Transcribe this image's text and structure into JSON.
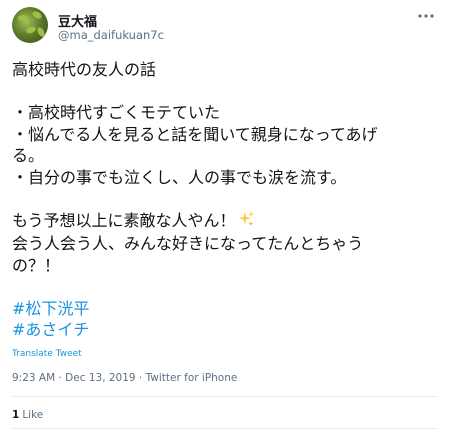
{
  "author": {
    "display_name": "豆大福",
    "handle": "@ma_daifukuan7c",
    "avatar_icon": "avatar-photo"
  },
  "tweet": {
    "lines": [
      "高校時代の友人の話",
      "",
      "・高校時代すごくモテていた",
      "・悩んでる人を見ると話を聞いて親身になってあげ",
      "る。",
      "・自分の事でも泣くし、人の事でも涙を流す。",
      "",
      "もう予想以上に素敵な人やん！",
      "会う人会う人、みんな好きになってたんとちゃう",
      "の？！",
      ""
    ],
    "emoji": "sparkles-icon",
    "hashtags": [
      "#松下洸平",
      "#あさイチ"
    ],
    "translate_label": "Translate Tweet",
    "timestamp": "9:23 AM · Dec 13, 2019 · Twitter for iPhone"
  },
  "stats": {
    "like_count": "1",
    "like_label": "Like"
  },
  "colors": {
    "link": "#1b95e0",
    "secondary_text": "#5b7083",
    "divider": "#e6ecf0",
    "sparkle": "#ffcc4d"
  }
}
